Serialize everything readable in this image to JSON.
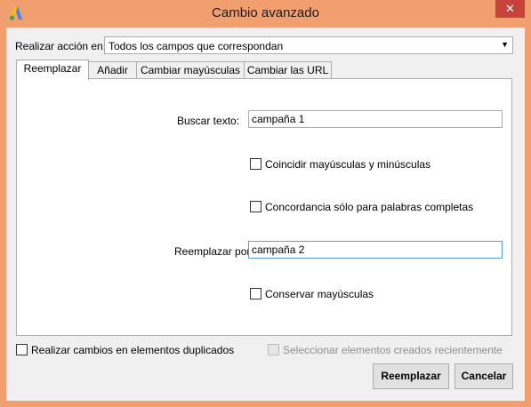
{
  "window": {
    "title": "Cambio avanzado",
    "close_symbol": "✕",
    "accent_color": "#f19f6e",
    "icons": [
      "adwords-logo-icon",
      "close-icon",
      "chevron-down-icon"
    ]
  },
  "action": {
    "label": "Realizar acción en:",
    "selected": "Todos los campos que correspondan"
  },
  "tabs": [
    {
      "label": "Reemplazar",
      "active": true
    },
    {
      "label": "Añadir",
      "active": false
    },
    {
      "label": "Cambiar mayúsculas",
      "active": false
    },
    {
      "label": "Cambiar las URL",
      "active": false
    }
  ],
  "replace_tab": {
    "search_label": "Buscar texto:",
    "search_value": "campaña 1",
    "match_case_label": "Coincidir mayúsculas y minúsculas",
    "match_case_checked": false,
    "whole_words_label": "Concordancia sólo para palabras completas",
    "whole_words_checked": false,
    "replace_label": "Reemplazar por:",
    "replace_value": "campaña 2",
    "keep_case_label": "Conservar mayúsculas",
    "keep_case_checked": false
  },
  "footer": {
    "duplicates_label": "Realizar cambios en elementos duplicados",
    "duplicates_checked": false,
    "recent_label": "Seleccionar elementos creados recientemente",
    "recent_enabled": false,
    "replace_button": "Reemplazar",
    "cancel_button": "Cancelar"
  }
}
